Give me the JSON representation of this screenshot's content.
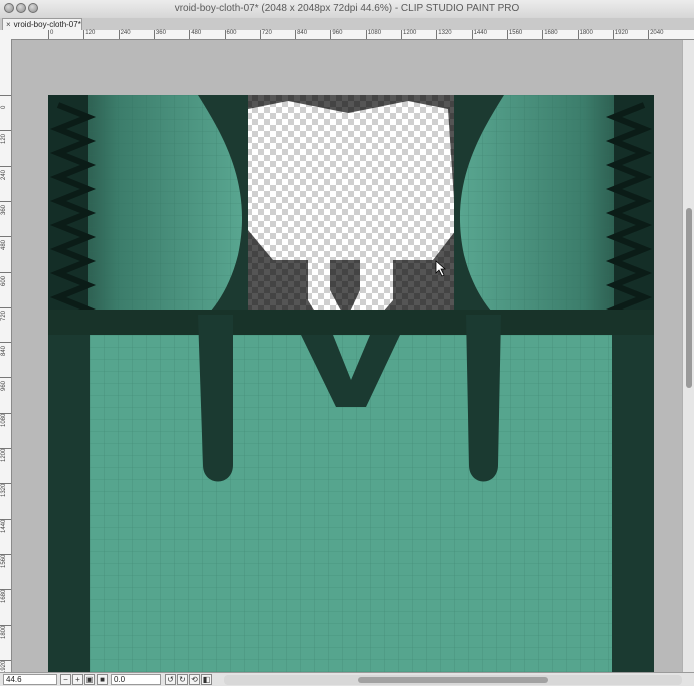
{
  "window": {
    "title": "vroid-boy-cloth-07* (2048 x 2048px 72dpi 44.6%)  - CLIP STUDIO PAINT PRO"
  },
  "tab": {
    "label": "vroid-boy-cloth-07*",
    "close_glyph": "×"
  },
  "ruler": {
    "h_labels": [
      "0",
      "120",
      "240",
      "360",
      "480",
      "600",
      "720",
      "840",
      "960",
      "1080",
      "1200",
      "1320",
      "1440",
      "1560",
      "1680",
      "1800",
      "1920",
      "2040"
    ],
    "v_labels": [
      "0",
      "120",
      "240",
      "360",
      "480",
      "600",
      "720",
      "840",
      "960",
      "1080",
      "1200",
      "1320",
      "1440",
      "1560",
      "1680",
      "1800",
      "1920"
    ]
  },
  "status": {
    "zoom": "44.6",
    "angle": "0.0"
  },
  "colors": {
    "cloth": "#56a58e",
    "dark_band": "#1c3a31",
    "darkest": "#0f241e",
    "transparent_checker": "#ffffff",
    "canvas_bg": "#b9b9b9"
  },
  "icons": {
    "zoom_out": "zoom-out-icon",
    "zoom_in": "zoom-in-icon",
    "fit": "fit-icon",
    "rotate_left": "rotate-left-icon",
    "rotate_right": "rotate-right-icon",
    "reset": "reset-icon",
    "cursor": "arrow-cursor-icon"
  }
}
